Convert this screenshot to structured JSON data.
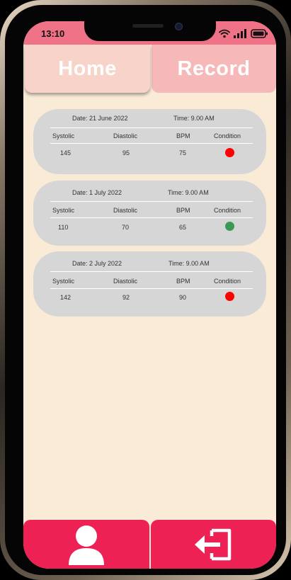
{
  "status_bar": {
    "time": "13:10",
    "icons": [
      "wifi-icon",
      "signal-icon",
      "battery-icon"
    ]
  },
  "tabs": [
    {
      "label": "Home",
      "active": false
    },
    {
      "label": "Record",
      "active": true
    }
  ],
  "records": [
    {
      "date": "Date: 21 June 2022",
      "time": "Time: 9.00 AM",
      "headers": {
        "systolic": "Systolic",
        "diastolic": "Diastolic",
        "bpm": "BPM",
        "condition": "Condition"
      },
      "systolic": "145",
      "diastolic": "95",
      "bpm": "75",
      "condition_color": "#ff0000"
    },
    {
      "date": "Date: 1 July 2022",
      "time": "Time: 9.00 AM",
      "headers": {
        "systolic": "Systolic",
        "diastolic": "Diastolic",
        "bpm": "BPM",
        "condition": "Condition"
      },
      "systolic": "110",
      "diastolic": "70",
      "bpm": "65",
      "condition_color": "#3a9a55"
    },
    {
      "date": "Date: 2 July 2022",
      "time": "Time: 9.00 AM",
      "headers": {
        "systolic": "Systolic",
        "diastolic": "Diastolic",
        "bpm": "BPM",
        "condition": "Condition"
      },
      "systolic": "142",
      "diastolic": "92",
      "bpm": "90",
      "condition_color": "#ff0000"
    }
  ],
  "bottom_nav": {
    "left_icon": "profile-icon",
    "right_icon": "logout-icon",
    "color": "#ee2155"
  },
  "colors": {
    "background": "#faebd7",
    "status_bar": "#f07286",
    "home_tab": "#f8d3ca",
    "record_tab": "#f6b8b8",
    "card": "#d6d6d6"
  }
}
